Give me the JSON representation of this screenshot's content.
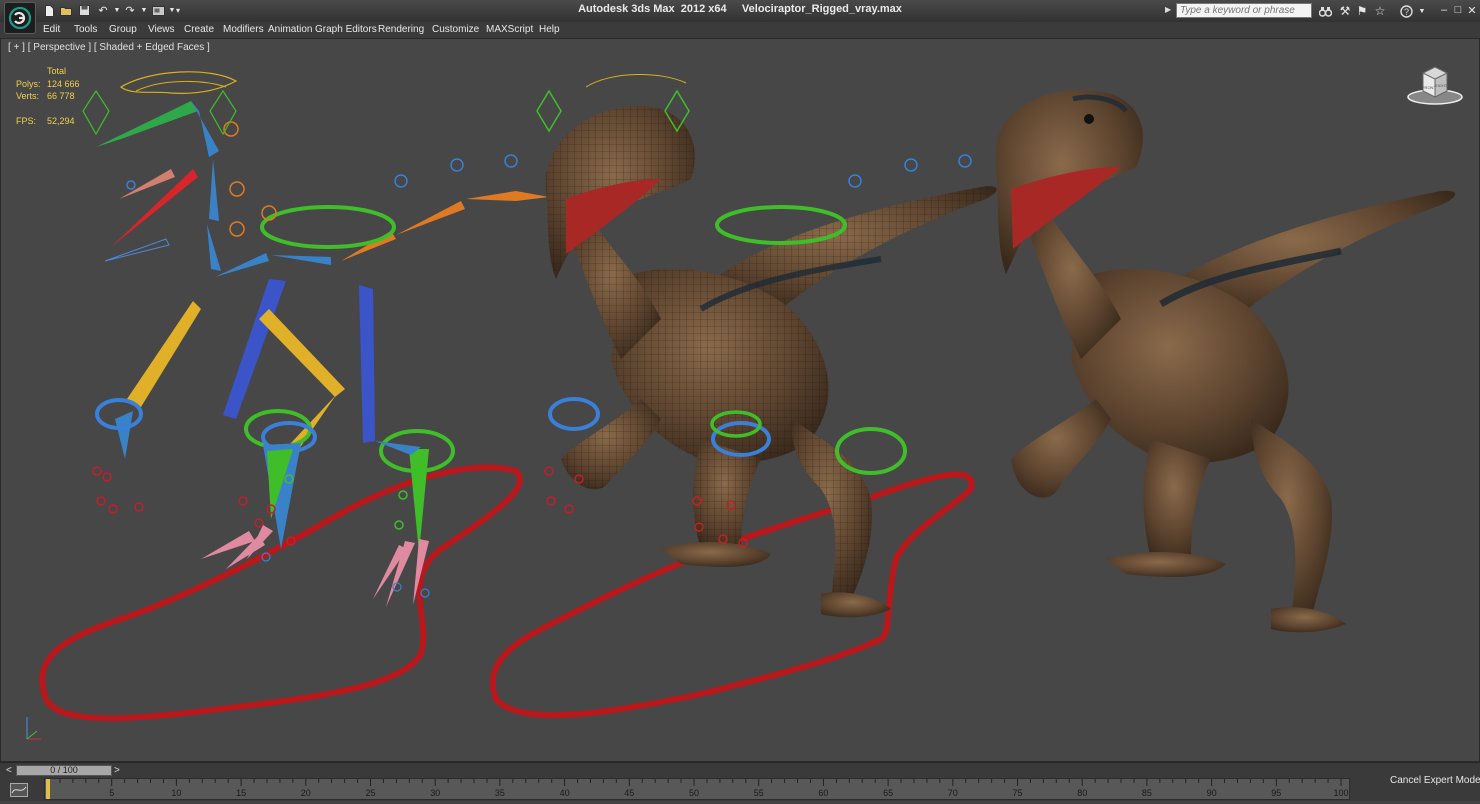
{
  "app": {
    "title": "Autodesk 3ds Max  2012 x64     Velociraptor_Rigged_vray.max",
    "logo": "3ds-max-logo",
    "search_placeholder": "Type a keyword or phrase",
    "quick_access_icons": [
      "new-file-icon",
      "open-file-icon",
      "save-icon",
      "undo-icon",
      "dropdown-arrow-icon",
      "redo-icon",
      "dropdown-arrow-icon",
      "project-folder-icon",
      "dropdown-arrow-icon",
      "customize-quick-access-icon"
    ]
  },
  "menu": [
    "Edit",
    "Tools",
    "Group",
    "Views",
    "Create",
    "Modifiers",
    "Animation",
    "Graph Editors",
    "Rendering",
    "Customize",
    "MAXScript",
    "Help"
  ],
  "viewport": {
    "label": "[ + ] [ Perspective ] [ Shaded + Edged Faces ]",
    "stats": {
      "total_label": "Total",
      "polys_label": "Polys:",
      "polys_value": "124 666",
      "verts_label": "Verts:",
      "verts_value": "66 778",
      "fps_label": "FPS:",
      "fps_value": "52,294"
    },
    "viewcube_labels": {
      "front": "FRONT",
      "right": "RIGHT"
    }
  },
  "timeline": {
    "current": "0 / 100",
    "prev": "<",
    "next": ">",
    "ticks": [
      "0",
      "5",
      "10",
      "15",
      "20",
      "25",
      "30",
      "35",
      "40",
      "45",
      "50",
      "55",
      "60",
      "65",
      "70",
      "75",
      "80",
      "85",
      "90",
      "95",
      "100"
    ],
    "range": [
      0,
      100
    ],
    "position": 0
  },
  "status": {
    "expert_mode_button": "Cancel Expert Mode"
  },
  "colors": {
    "viewport_bg": "#474747",
    "stats_text": "#f0d24a",
    "foot_controller": "#b8181b",
    "ik_ring_blue": "#3a7fd8",
    "ik_ring_green": "#3fbe2a"
  }
}
